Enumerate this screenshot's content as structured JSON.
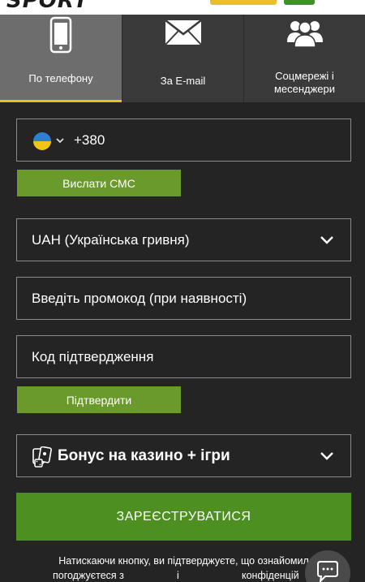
{
  "header": {
    "logo_text": "SPORT",
    "accent_yellow": "#e8c02a",
    "accent_green": "#3f8f2a"
  },
  "tabs": [
    {
      "label": "По телефону",
      "icon": "phone-icon",
      "active": true
    },
    {
      "label": "За E-mail",
      "icon": "envelope-icon",
      "active": false
    },
    {
      "label": "Соцмережі і месенджери",
      "icon": "users-icon",
      "active": false
    }
  ],
  "phone": {
    "flag": "ukraine-flag-icon",
    "prefix": "+380",
    "value": ""
  },
  "sms_button": {
    "label": "Вислати СМС"
  },
  "currency": {
    "selected": "UAH (Українська гривня)"
  },
  "promo": {
    "placeholder": "Введіть промокод (при наявності)"
  },
  "code": {
    "placeholder": "Код підтвердження"
  },
  "confirm_button": {
    "label": "Підтвердити"
  },
  "bonus": {
    "selected": "Бонус на казино + ігри",
    "icon": "casino-icon"
  },
  "register_button": {
    "label": "ЗАРЕЄСТРУВАТИСЯ"
  },
  "terms": {
    "line1": "Натискаючи кнопку, ви підтверджуєте, що ознайомил",
    "line2_a": "погоджуєтеся з",
    "line2_b": "і",
    "line2_c": "конфіденцій"
  },
  "colors": {
    "background": "#242424",
    "button_green": "#6a9a2c",
    "register_green": "#4e8f22",
    "active_tab": "#6d6d6d"
  }
}
